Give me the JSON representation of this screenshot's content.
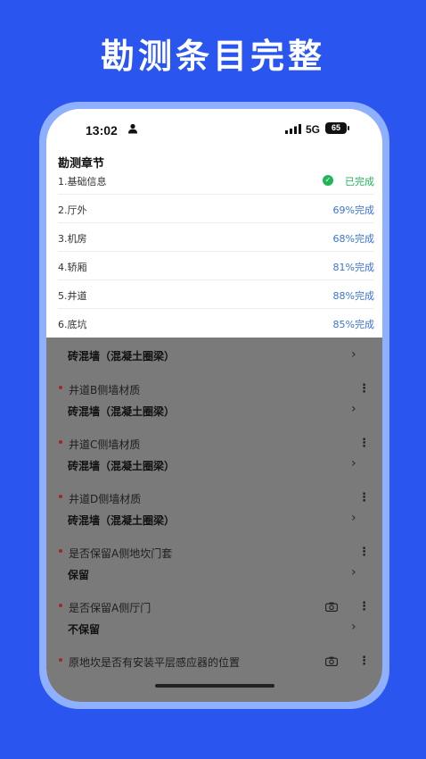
{
  "headline": "勘测条目完整",
  "status_bar": {
    "time": "13:02",
    "network": "5G",
    "battery": "65"
  },
  "section_title": "勘测章节",
  "chapters": [
    {
      "label": "1.基础信息",
      "status": "已完成"
    },
    {
      "label": "2.厅外",
      "status": "69%完成"
    },
    {
      "label": "3.机房",
      "status": "68%完成"
    },
    {
      "label": "4.轿厢",
      "status": "81%完成"
    },
    {
      "label": "5.井道",
      "status": "88%完成"
    },
    {
      "label": "6.底坑",
      "status": "85%完成"
    }
  ],
  "form": {
    "partial_top_value": "砖混墙（混凝土圈梁）",
    "items": [
      {
        "label": "井道B侧墙材质",
        "value": "砖混墙（混凝土圈梁）"
      },
      {
        "label": "井道C侧墙材质",
        "value": "砖混墙（混凝土圈梁）"
      },
      {
        "label": "井道D侧墙材质",
        "value": "砖混墙（混凝土圈梁）"
      },
      {
        "label": "是否保留A侧地坎门套",
        "value": "保留"
      },
      {
        "label": "是否保留A侧厅门",
        "value": "不保留"
      },
      {
        "label": "原地坎是否有安装平层感应器的位置",
        "value": ""
      }
    ],
    "arrow": "›",
    "more": "⋮"
  },
  "colors": {
    "background": "#2a55ee",
    "progress": "#3a73d6",
    "done": "#22b45a"
  },
  "icons": [
    "person-icon",
    "signal-icon",
    "battery-icon",
    "check-circle-icon",
    "more-vert-icon",
    "chevron-right-icon",
    "camera-icon"
  ]
}
